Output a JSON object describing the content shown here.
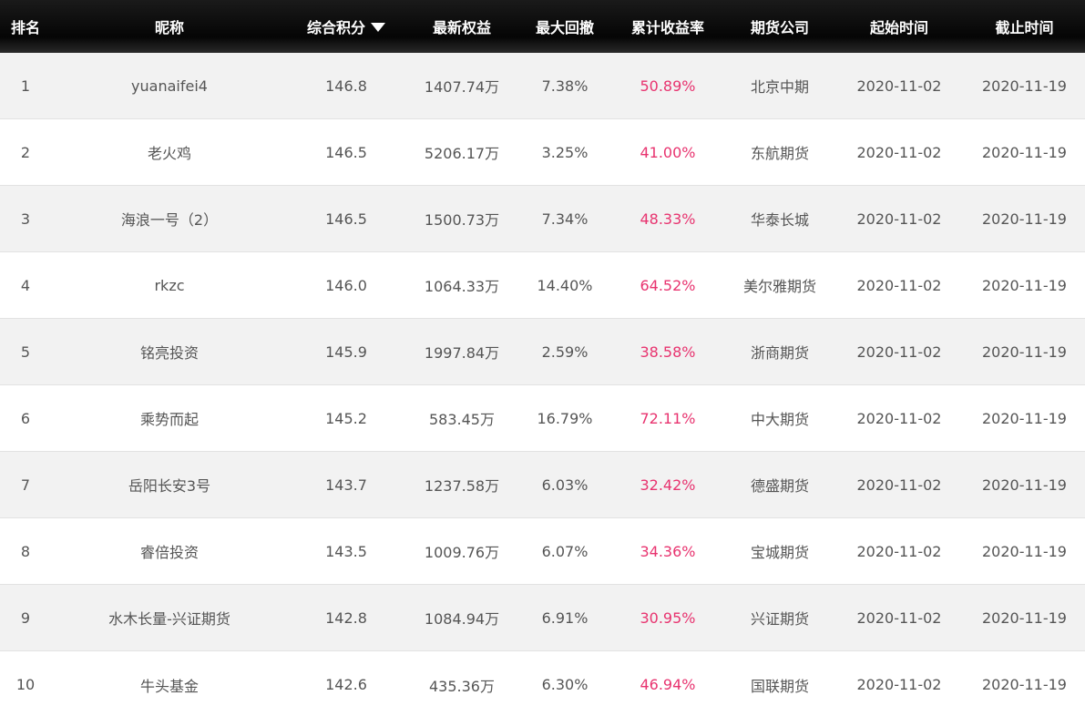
{
  "columns": {
    "rank": "排名",
    "nickname": "昵称",
    "score": "综合积分",
    "equity": "最新权益",
    "drawdown": "最大回撤",
    "return": "累计收益率",
    "company": "期货公司",
    "start": "起始时间",
    "end": "截止时间"
  },
  "colors": {
    "header_bg": "#0a0a0a",
    "header_text": "#ffffff",
    "return_color": "#e8336f",
    "row_alt": "#f2f2f2"
  },
  "rows": [
    {
      "rank": "1",
      "nickname": "yuanaifei4",
      "score": "146.8",
      "equity": "1407.74万",
      "drawdown": "7.38%",
      "return": "50.89%",
      "company": "北京中期",
      "start": "2020-11-02",
      "end": "2020-11-19"
    },
    {
      "rank": "2",
      "nickname": "老火鸡",
      "score": "146.5",
      "equity": "5206.17万",
      "drawdown": "3.25%",
      "return": "41.00%",
      "company": "东航期货",
      "start": "2020-11-02",
      "end": "2020-11-19"
    },
    {
      "rank": "3",
      "nickname": "海浪一号（2）",
      "score": "146.5",
      "equity": "1500.73万",
      "drawdown": "7.34%",
      "return": "48.33%",
      "company": "华泰长城",
      "start": "2020-11-02",
      "end": "2020-11-19"
    },
    {
      "rank": "4",
      "nickname": "rkzc",
      "score": "146.0",
      "equity": "1064.33万",
      "drawdown": "14.40%",
      "return": "64.52%",
      "company": "美尔雅期货",
      "start": "2020-11-02",
      "end": "2020-11-19"
    },
    {
      "rank": "5",
      "nickname": "铭亮投资",
      "score": "145.9",
      "equity": "1997.84万",
      "drawdown": "2.59%",
      "return": "38.58%",
      "company": "浙商期货",
      "start": "2020-11-02",
      "end": "2020-11-19"
    },
    {
      "rank": "6",
      "nickname": "乘势而起",
      "score": "145.2",
      "equity": "583.45万",
      "drawdown": "16.79%",
      "return": "72.11%",
      "company": "中大期货",
      "start": "2020-11-02",
      "end": "2020-11-19"
    },
    {
      "rank": "7",
      "nickname": "岳阳长安3号",
      "score": "143.7",
      "equity": "1237.58万",
      "drawdown": "6.03%",
      "return": "32.42%",
      "company": "德盛期货",
      "start": "2020-11-02",
      "end": "2020-11-19"
    },
    {
      "rank": "8",
      "nickname": "睿倍投资",
      "score": "143.5",
      "equity": "1009.76万",
      "drawdown": "6.07%",
      "return": "34.36%",
      "company": "宝城期货",
      "start": "2020-11-02",
      "end": "2020-11-19"
    },
    {
      "rank": "9",
      "nickname": "水木长量-兴证期货",
      "score": "142.8",
      "equity": "1084.94万",
      "drawdown": "6.91%",
      "return": "30.95%",
      "company": "兴证期货",
      "start": "2020-11-02",
      "end": "2020-11-19"
    },
    {
      "rank": "10",
      "nickname": "牛头基金",
      "score": "142.6",
      "equity": "435.36万",
      "drawdown": "6.30%",
      "return": "46.94%",
      "company": "国联期货",
      "start": "2020-11-02",
      "end": "2020-11-19"
    }
  ]
}
